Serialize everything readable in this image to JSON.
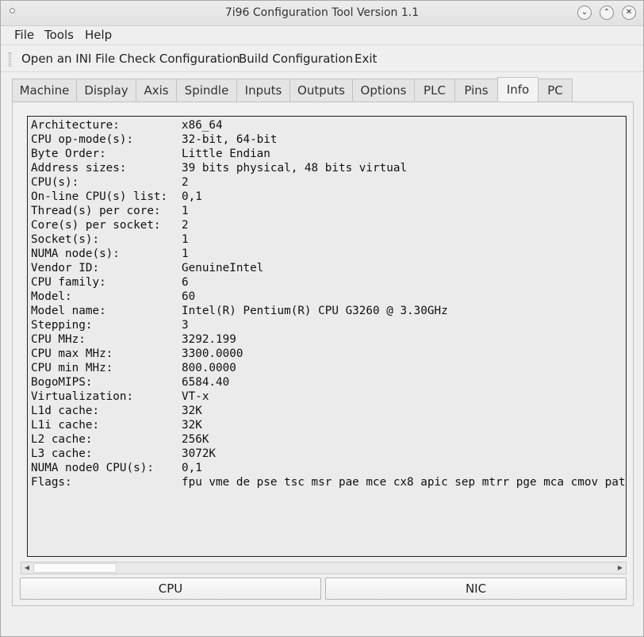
{
  "window": {
    "title": "7i96 Configuration Tool Version 1.1"
  },
  "menu": {
    "items": [
      "File",
      "Tools",
      "Help"
    ]
  },
  "toolbar": {
    "buttons": [
      "Open an INI File",
      "Check Configuration",
      "Build Configuration",
      "Exit"
    ]
  },
  "tabs": {
    "labels": [
      "Machine",
      "Display",
      "Axis",
      "Spindle",
      "Inputs",
      "Outputs",
      "Options",
      "PLC",
      "Pins",
      "Info",
      "PC"
    ],
    "active": "Info"
  },
  "info": {
    "rows": [
      {
        "key": "Architecture:",
        "value": "x86_64"
      },
      {
        "key": "CPU op-mode(s):",
        "value": "32-bit, 64-bit"
      },
      {
        "key": "Byte Order:",
        "value": "Little Endian"
      },
      {
        "key": "Address sizes:",
        "value": "39 bits physical, 48 bits virtual"
      },
      {
        "key": "CPU(s):",
        "value": "2"
      },
      {
        "key": "On-line CPU(s) list:",
        "value": "0,1"
      },
      {
        "key": "Thread(s) per core:",
        "value": "1"
      },
      {
        "key": "Core(s) per socket:",
        "value": "2"
      },
      {
        "key": "Socket(s):",
        "value": "1"
      },
      {
        "key": "NUMA node(s):",
        "value": "1"
      },
      {
        "key": "Vendor ID:",
        "value": "GenuineIntel"
      },
      {
        "key": "CPU family:",
        "value": "6"
      },
      {
        "key": "Model:",
        "value": "60"
      },
      {
        "key": "Model name:",
        "value": "Intel(R) Pentium(R) CPU G3260 @ 3.30GHz"
      },
      {
        "key": "Stepping:",
        "value": "3"
      },
      {
        "key": "CPU MHz:",
        "value": "3292.199"
      },
      {
        "key": "CPU max MHz:",
        "value": "3300.0000"
      },
      {
        "key": "CPU min MHz:",
        "value": "800.0000"
      },
      {
        "key": "BogoMIPS:",
        "value": "6584.40"
      },
      {
        "key": "Virtualization:",
        "value": "VT-x"
      },
      {
        "key": "L1d cache:",
        "value": "32K"
      },
      {
        "key": "L1i cache:",
        "value": "32K"
      },
      {
        "key": "L2 cache:",
        "value": "256K"
      },
      {
        "key": "L3 cache:",
        "value": "3072K"
      },
      {
        "key": "NUMA node0 CPU(s):",
        "value": "0,1"
      },
      {
        "key": "Flags:",
        "value": "fpu vme de pse tsc msr pae mce cx8 apic sep mtrr pge mca cmov pat"
      }
    ]
  },
  "buttons": {
    "cpu": "CPU",
    "nic": "NIC"
  },
  "icons": {
    "minimize": "chevron-down-icon",
    "maximize": "chevron-up-icon",
    "close": "close-icon",
    "scroll_left": "triangle-left-icon",
    "scroll_right": "triangle-right-icon"
  }
}
